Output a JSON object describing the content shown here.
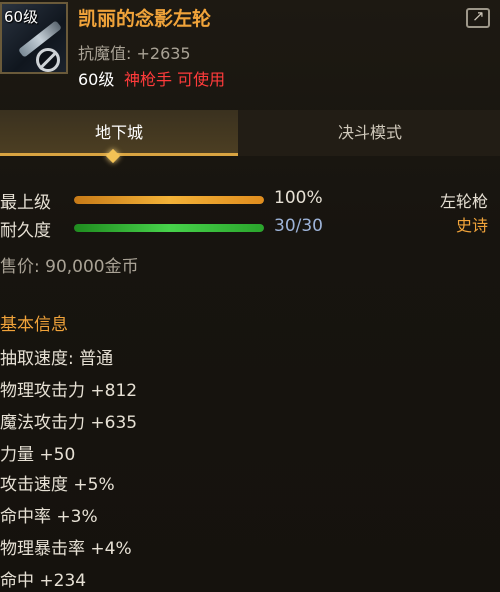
{
  "item": {
    "level_badge": "60级",
    "name": "凯丽的念影左轮",
    "resist_label": "抗魔值: +2635",
    "req_level": "60级",
    "req_class": "神枪手 可使用",
    "icons": {
      "share": "share-icon",
      "item": "revolver-icon",
      "banned": "no-entry-icon"
    }
  },
  "tabs": [
    {
      "label": "地下城",
      "active": true
    },
    {
      "label": "决斗模式",
      "active": false
    }
  ],
  "bars": {
    "upgrade": {
      "label": "最上级",
      "value_text": "100%",
      "fill_fraction": 1.0,
      "color": "#f3b238"
    },
    "durability": {
      "label": "耐久度",
      "value_text": "30/30",
      "fill_fraction": 1.0,
      "color": "#47d24b"
    }
  },
  "side": {
    "weapon_type": "左轮枪",
    "rarity": "史诗",
    "rarity_color": "#f0a33a"
  },
  "price": "售价: 90,000金币",
  "basic_info": {
    "title": "基本信息",
    "stats": [
      "抽取速度: 普通",
      "物理攻击力 +812",
      "魔法攻击力 +635",
      "力量 +50",
      "攻击速度 +5%",
      "命中率 +3%",
      "物理暴击率 +4%",
      "命中 +234"
    ]
  },
  "colors": {
    "accent": "#f0a33a",
    "warning": "#ff3b3b",
    "background": "#17140f"
  }
}
